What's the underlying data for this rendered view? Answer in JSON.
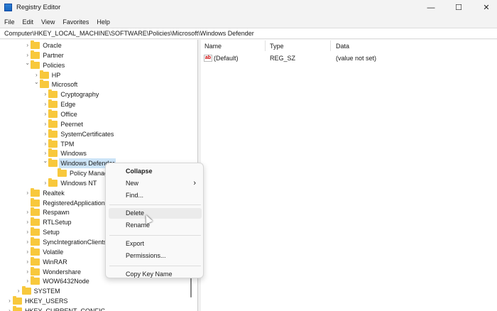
{
  "window": {
    "title": "Registry Editor",
    "minimize": "—",
    "maximize": "☐",
    "close": "✕"
  },
  "menu": [
    "File",
    "Edit",
    "View",
    "Favorites",
    "Help"
  ],
  "address": "Computer\\HKEY_LOCAL_MACHINE\\SOFTWARE\\Policies\\Microsoft\\Windows Defender",
  "tree": [
    {
      "label": "Oracle",
      "level": 3,
      "arrow": "right"
    },
    {
      "label": "Partner",
      "level": 3,
      "arrow": "right"
    },
    {
      "label": "Policies",
      "level": 3,
      "arrow": "down"
    },
    {
      "label": "HP",
      "level": 4,
      "arrow": "right"
    },
    {
      "label": "Microsoft",
      "level": 4,
      "arrow": "down"
    },
    {
      "label": "Cryptography",
      "level": 5,
      "arrow": "right"
    },
    {
      "label": "Edge",
      "level": 5,
      "arrow": "right"
    },
    {
      "label": "Office",
      "level": 5,
      "arrow": "right"
    },
    {
      "label": "Peernet",
      "level": 5,
      "arrow": "right"
    },
    {
      "label": "SystemCertificates",
      "level": 5,
      "arrow": "right"
    },
    {
      "label": "TPM",
      "level": 5,
      "arrow": "right"
    },
    {
      "label": "Windows",
      "level": 5,
      "arrow": "right"
    },
    {
      "label": "Windows Defender",
      "level": 5,
      "arrow": "down",
      "selected": true
    },
    {
      "label": "Policy Manager",
      "level": 6,
      "arrow": "none"
    },
    {
      "label": "Windows NT",
      "level": 5,
      "arrow": "right"
    },
    {
      "label": "Realtek",
      "level": 3,
      "arrow": "right"
    },
    {
      "label": "RegisteredApplications",
      "level": 3,
      "arrow": "none"
    },
    {
      "label": "Respawn",
      "level": 3,
      "arrow": "right"
    },
    {
      "label": "RTLSetup",
      "level": 3,
      "arrow": "right"
    },
    {
      "label": "Setup",
      "level": 3,
      "arrow": "right"
    },
    {
      "label": "SyncIntegrationClients",
      "level": 3,
      "arrow": "right"
    },
    {
      "label": "Volatile",
      "level": 3,
      "arrow": "right"
    },
    {
      "label": "WinRAR",
      "level": 3,
      "arrow": "right"
    },
    {
      "label": "Wondershare",
      "level": 3,
      "arrow": "right"
    },
    {
      "label": "WOW6432Node",
      "level": 3,
      "arrow": "right"
    },
    {
      "label": "SYSTEM",
      "level": 2,
      "arrow": "right"
    },
    {
      "label": "HKEY_USERS",
      "level": 1,
      "arrow": "right"
    },
    {
      "label": "HKEY_CURRENT_CONFIG",
      "level": 1,
      "arrow": "right"
    }
  ],
  "list": {
    "columns": [
      "Name",
      "Type",
      "Data"
    ],
    "rows": [
      {
        "name": "(Default)",
        "type": "REG_SZ",
        "data": "(value not set)",
        "icon": "string-value-icon"
      }
    ]
  },
  "context_menu": {
    "items": [
      {
        "label": "Collapse",
        "bold": true
      },
      {
        "label": "New",
        "submenu": true
      },
      {
        "label": "Find..."
      },
      {
        "sep": true
      },
      {
        "label": "Delete",
        "hover": true
      },
      {
        "label": "Rename"
      },
      {
        "sep": true
      },
      {
        "label": "Export"
      },
      {
        "label": "Permissions..."
      },
      {
        "sep": true
      },
      {
        "label": "Copy Key Name"
      }
    ]
  }
}
